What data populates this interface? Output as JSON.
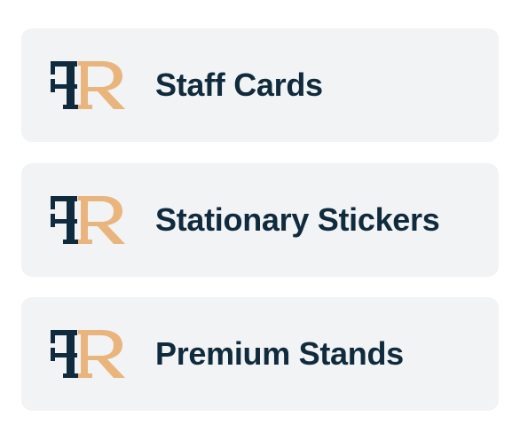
{
  "colors": {
    "card_background": "#f2f3f5",
    "text": "#0f2b3d",
    "logo_primary": "#0f2b3d",
    "logo_accent": "#e9b57c"
  },
  "items": [
    {
      "label": "Staff Cards",
      "icon": "fr-logo-icon"
    },
    {
      "label": "Stationary Stickers",
      "icon": "fr-logo-icon"
    },
    {
      "label": "Premium Stands",
      "icon": "fr-logo-icon"
    }
  ]
}
